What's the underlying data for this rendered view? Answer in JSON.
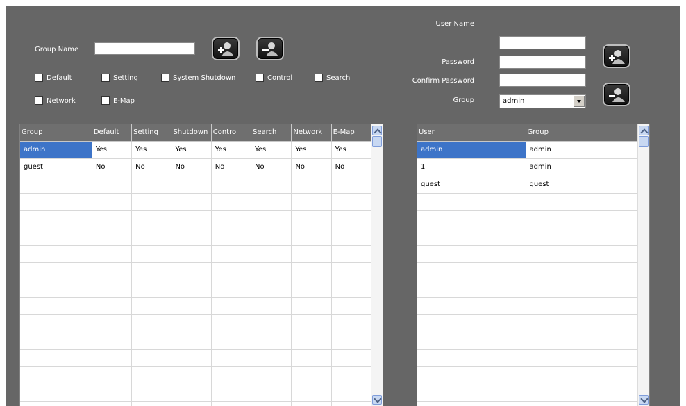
{
  "group_form": {
    "group_name_label": "Group Name",
    "group_name_value": "",
    "add_icon": "add-group-icon",
    "remove_icon": "remove-group-icon",
    "permissions": [
      "Default",
      "Setting",
      "System Shutdown",
      "Control",
      "Search",
      "Network",
      "E-Map"
    ]
  },
  "user_form": {
    "user_name_label": "User Name",
    "user_name_value": "",
    "password_label": "Password",
    "confirm_password_label": "Confirm Password",
    "group_label": "Group",
    "group_selected": "admin",
    "add_icon": "add-user-icon",
    "remove_icon": "remove-user-icon"
  },
  "groups_table": {
    "columns": [
      "Group",
      "Default",
      "Setting",
      "Shutdown",
      "Control",
      "Search",
      "Network",
      "E-Map"
    ],
    "rows": [
      [
        "admin",
        "Yes",
        "Yes",
        "Yes",
        "Yes",
        "Yes",
        "Yes",
        "Yes"
      ],
      [
        "guest",
        "No",
        "No",
        "No",
        "No",
        "No",
        "No",
        "No"
      ]
    ],
    "selected_row": 0
  },
  "users_table": {
    "columns": [
      "User",
      "Group"
    ],
    "rows": [
      [
        "admin",
        "admin"
      ],
      [
        "1",
        "admin"
      ],
      [
        "guest",
        "guest"
      ]
    ],
    "selected_row": 0
  },
  "colors": {
    "panel_bg": "#666666",
    "selection": "#3d74c8",
    "header_bg": "#6f6f6f"
  }
}
